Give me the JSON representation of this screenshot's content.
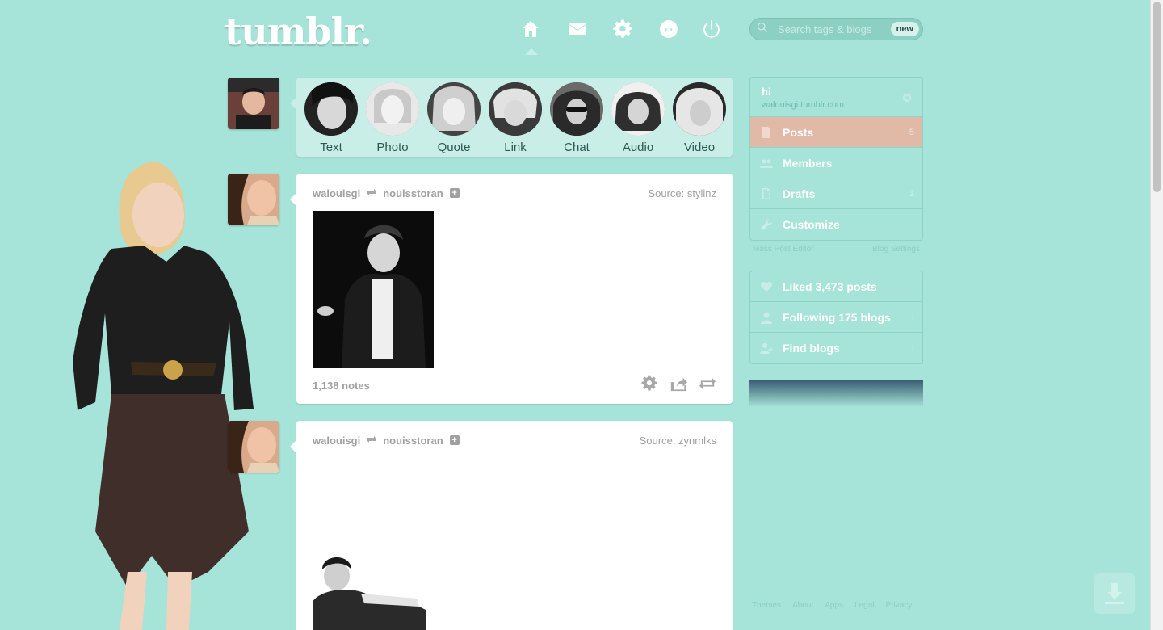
{
  "brand": {
    "logo": "tumblr."
  },
  "header": {
    "nav": [
      {
        "name": "home",
        "icon": "home-icon"
      },
      {
        "name": "messages",
        "icon": "envelope-icon"
      },
      {
        "name": "settings",
        "icon": "gear-icon"
      },
      {
        "name": "activity",
        "icon": "activity-icon"
      },
      {
        "name": "logout",
        "icon": "power-icon"
      }
    ],
    "search": {
      "placeholder": "Search tags & blogs",
      "badge": "new"
    }
  },
  "post_types": [
    {
      "label": "Text"
    },
    {
      "label": "Photo"
    },
    {
      "label": "Quote"
    },
    {
      "label": "Link"
    },
    {
      "label": "Chat"
    },
    {
      "label": "Audio"
    },
    {
      "label": "Video"
    }
  ],
  "posts": [
    {
      "user": "walouisgi",
      "reblogged_from": "nouisstoran",
      "source": "Source: stylinz",
      "notes": "1,138 notes"
    },
    {
      "user": "walouisgi",
      "reblogged_from": "nouisstoran",
      "source": "Source: zynmlks"
    }
  ],
  "sidebar": {
    "blog": {
      "title": "hi",
      "url": "walouisgi.tumblr.com"
    },
    "blog_menu": [
      {
        "label": "Posts",
        "count": "5",
        "icon": "document-icon",
        "active": true
      },
      {
        "label": "Members",
        "count": "",
        "icon": "members-icon",
        "active": false
      },
      {
        "label": "Drafts",
        "count": "1",
        "icon": "drafts-icon",
        "active": false
      },
      {
        "label": "Customize",
        "count": "",
        "icon": "wrench-icon",
        "active": false
      }
    ],
    "blog_links": {
      "mass_editor": "Mass Post Editor",
      "blog_settings": "Blog Settings"
    },
    "account_menu": [
      {
        "label": "Liked 3,473 posts",
        "icon": "heart-icon"
      },
      {
        "label": "Following 175 blogs",
        "icon": "person-icon"
      },
      {
        "label": "Find blogs",
        "icon": "person-add-icon"
      }
    ]
  },
  "footer": {
    "links": [
      "Themes",
      "About",
      "Apps",
      "Legal",
      "Privacy"
    ]
  },
  "colors": {
    "background": "#a6e3d8",
    "active_item": "#e0b9a7",
    "post_bg": "#ffffff"
  }
}
